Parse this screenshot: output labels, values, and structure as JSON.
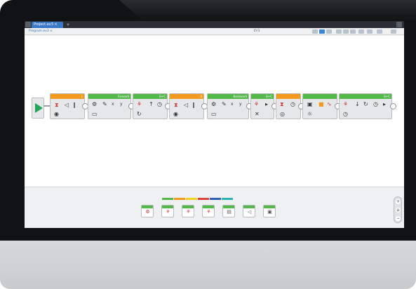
{
  "window": {
    "project_tab": "Project.ev3 ×",
    "new_tab": "+"
  },
  "toolbar": {
    "program_tab": "Program.ev3 ×",
    "center_label": "EV3"
  },
  "program": {
    "block_labels": [
      "1",
      "Forward",
      "B+C",
      "2",
      "Backward",
      "B+C",
      "B+C"
    ]
  },
  "zoom": {
    "plus": "+",
    "minus": "−",
    "fit": "⌂"
  },
  "colors": {
    "accent_blue": "#3a86d6",
    "orange_block": "#f39a1e",
    "green_block": "#52b848"
  }
}
